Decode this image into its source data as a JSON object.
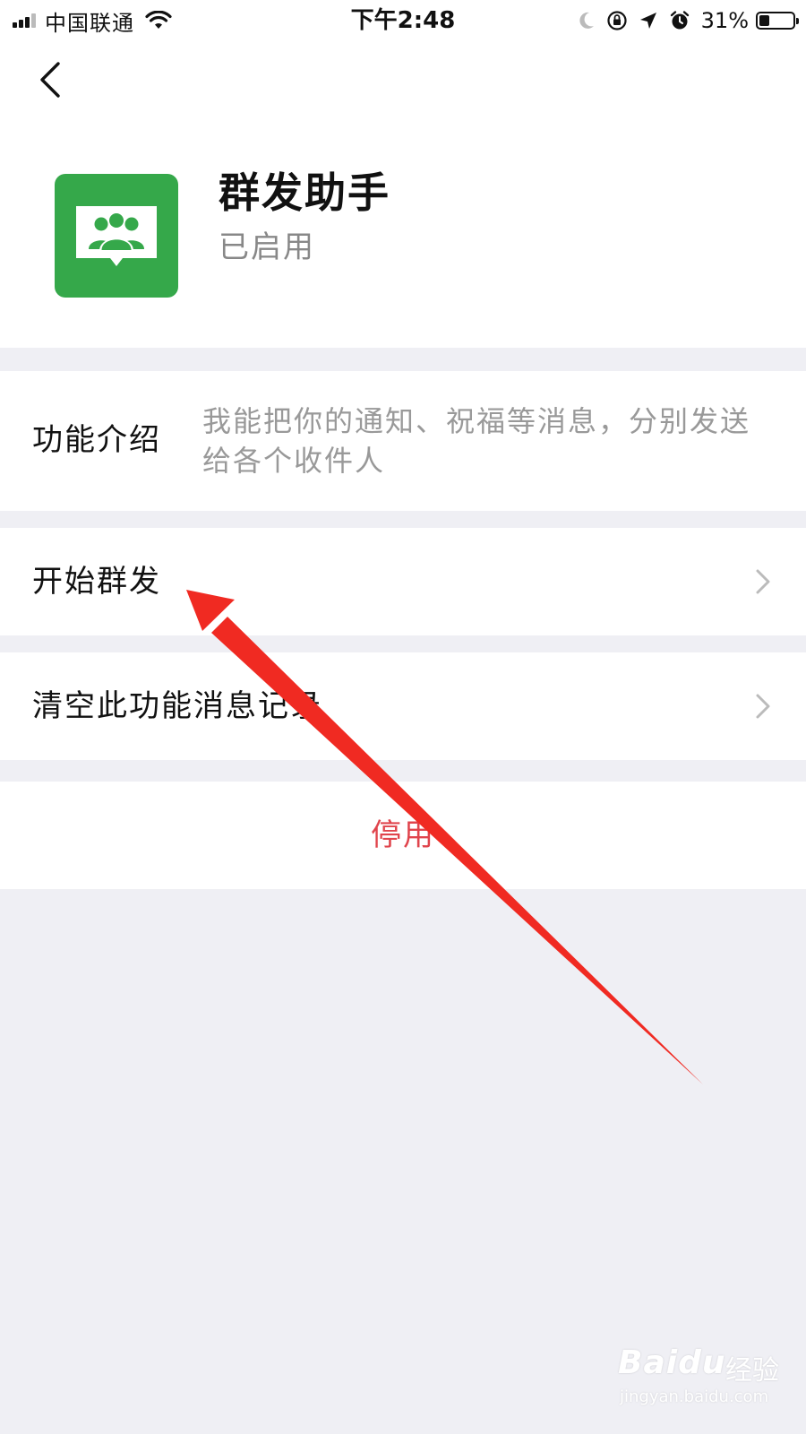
{
  "status_bar": {
    "carrier": "中国联通",
    "time": "下午2:48",
    "battery_percent_label": "31%",
    "battery_level": 0.31,
    "icons": [
      "signal-icon",
      "wifi-icon",
      "moon-icon",
      "orientation-lock-icon",
      "location-icon",
      "alarm-icon",
      "battery-icon"
    ]
  },
  "nav": {
    "back_icon": "chevron-left-icon"
  },
  "app": {
    "title": "群发助手",
    "status": "已启用",
    "icon": "group-chat-icon",
    "icon_color": "#35a84a"
  },
  "intro": {
    "label": "功能介绍",
    "description": "我能把你的通知、祝福等消息，分别发送给各个收件人"
  },
  "menu": {
    "start_label": "开始群发",
    "clear_label": "清空此功能消息记录"
  },
  "disable": {
    "label": "停用",
    "color": "#e0444c"
  },
  "annotation": {
    "arrow_color": "#f02a22"
  },
  "watermark": {
    "brand": "Baidu",
    "brand_cn": "经验",
    "url": "jingyan.baidu.com"
  }
}
